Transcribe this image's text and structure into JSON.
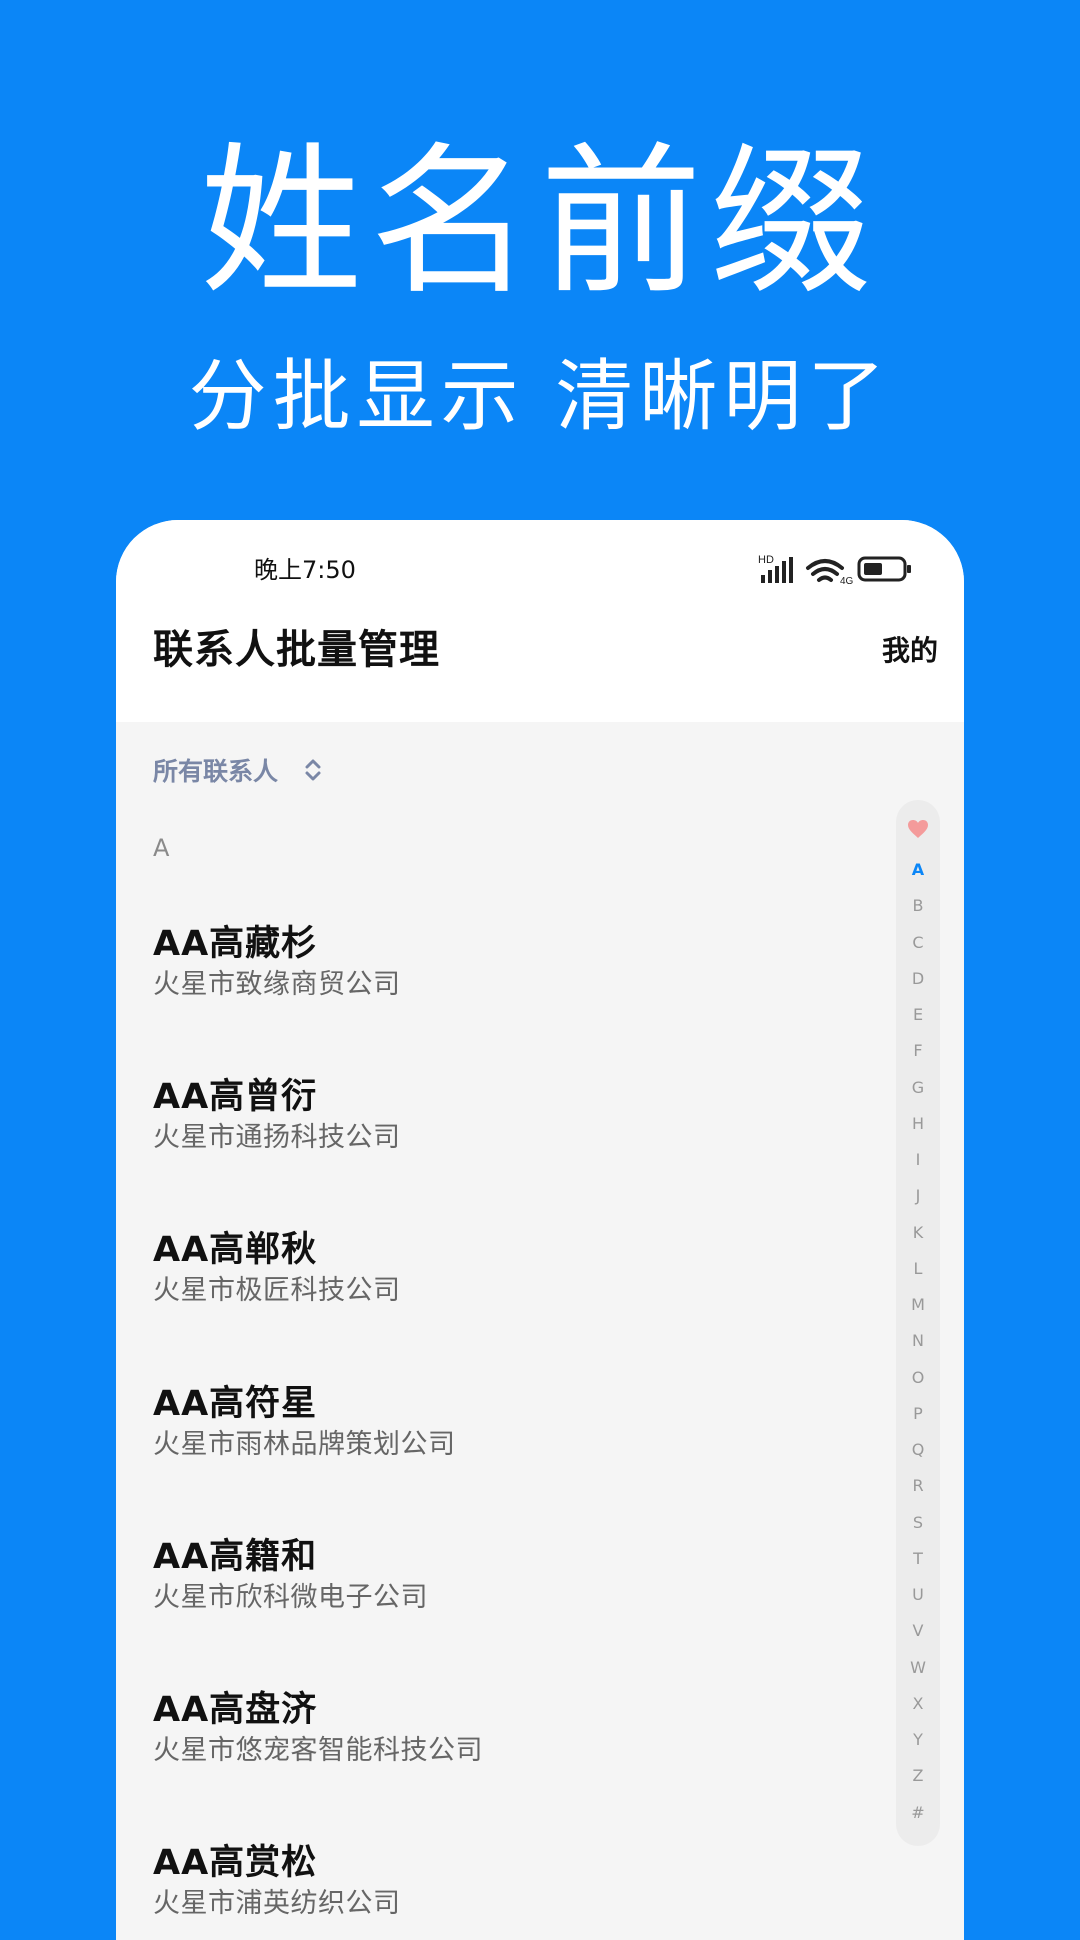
{
  "promo": {
    "title": "姓名前缀",
    "subtitle": "分批显示  清晰明了"
  },
  "status_bar": {
    "time": "晚上7:50",
    "network": "HD",
    "network_type": "4G",
    "battery_icon": "battery-icon",
    "wifi_icon": "wifi-icon",
    "signal_icon": "signal-icon"
  },
  "header": {
    "title": "联系人批量管理",
    "my_label": "我的"
  },
  "filter": {
    "label": "所有联系人",
    "icon": "chevron-up-down-icon"
  },
  "section": {
    "letter": "A"
  },
  "contacts": [
    {
      "name": "AA高藏杉",
      "company": "火星市致缘商贸公司"
    },
    {
      "name": "AA高曾衍",
      "company": "火星市通扬科技公司"
    },
    {
      "name": "AA高郸秋",
      "company": "火星市极匠科技公司"
    },
    {
      "name": "AA高符星",
      "company": "火星市雨林品牌策划公司"
    },
    {
      "name": "AA高籍和",
      "company": "火星市欣科微电子公司"
    },
    {
      "name": "AA高盘济",
      "company": "火星市悠宠客智能科技公司"
    },
    {
      "name": "AA高赏松",
      "company": "火星市浦英纺织公司"
    }
  ],
  "alphabet": [
    "A",
    "B",
    "C",
    "D",
    "E",
    "F",
    "G",
    "H",
    "I",
    "J",
    "K",
    "L",
    "M",
    "N",
    "O",
    "P",
    "Q",
    "R",
    "S",
    "T",
    "U",
    "V",
    "W",
    "X",
    "Y",
    "Z",
    "#"
  ],
  "colors": {
    "brand": "#0b86f7",
    "heart": "#f49b9b",
    "filter_text": "#7a87a6"
  }
}
